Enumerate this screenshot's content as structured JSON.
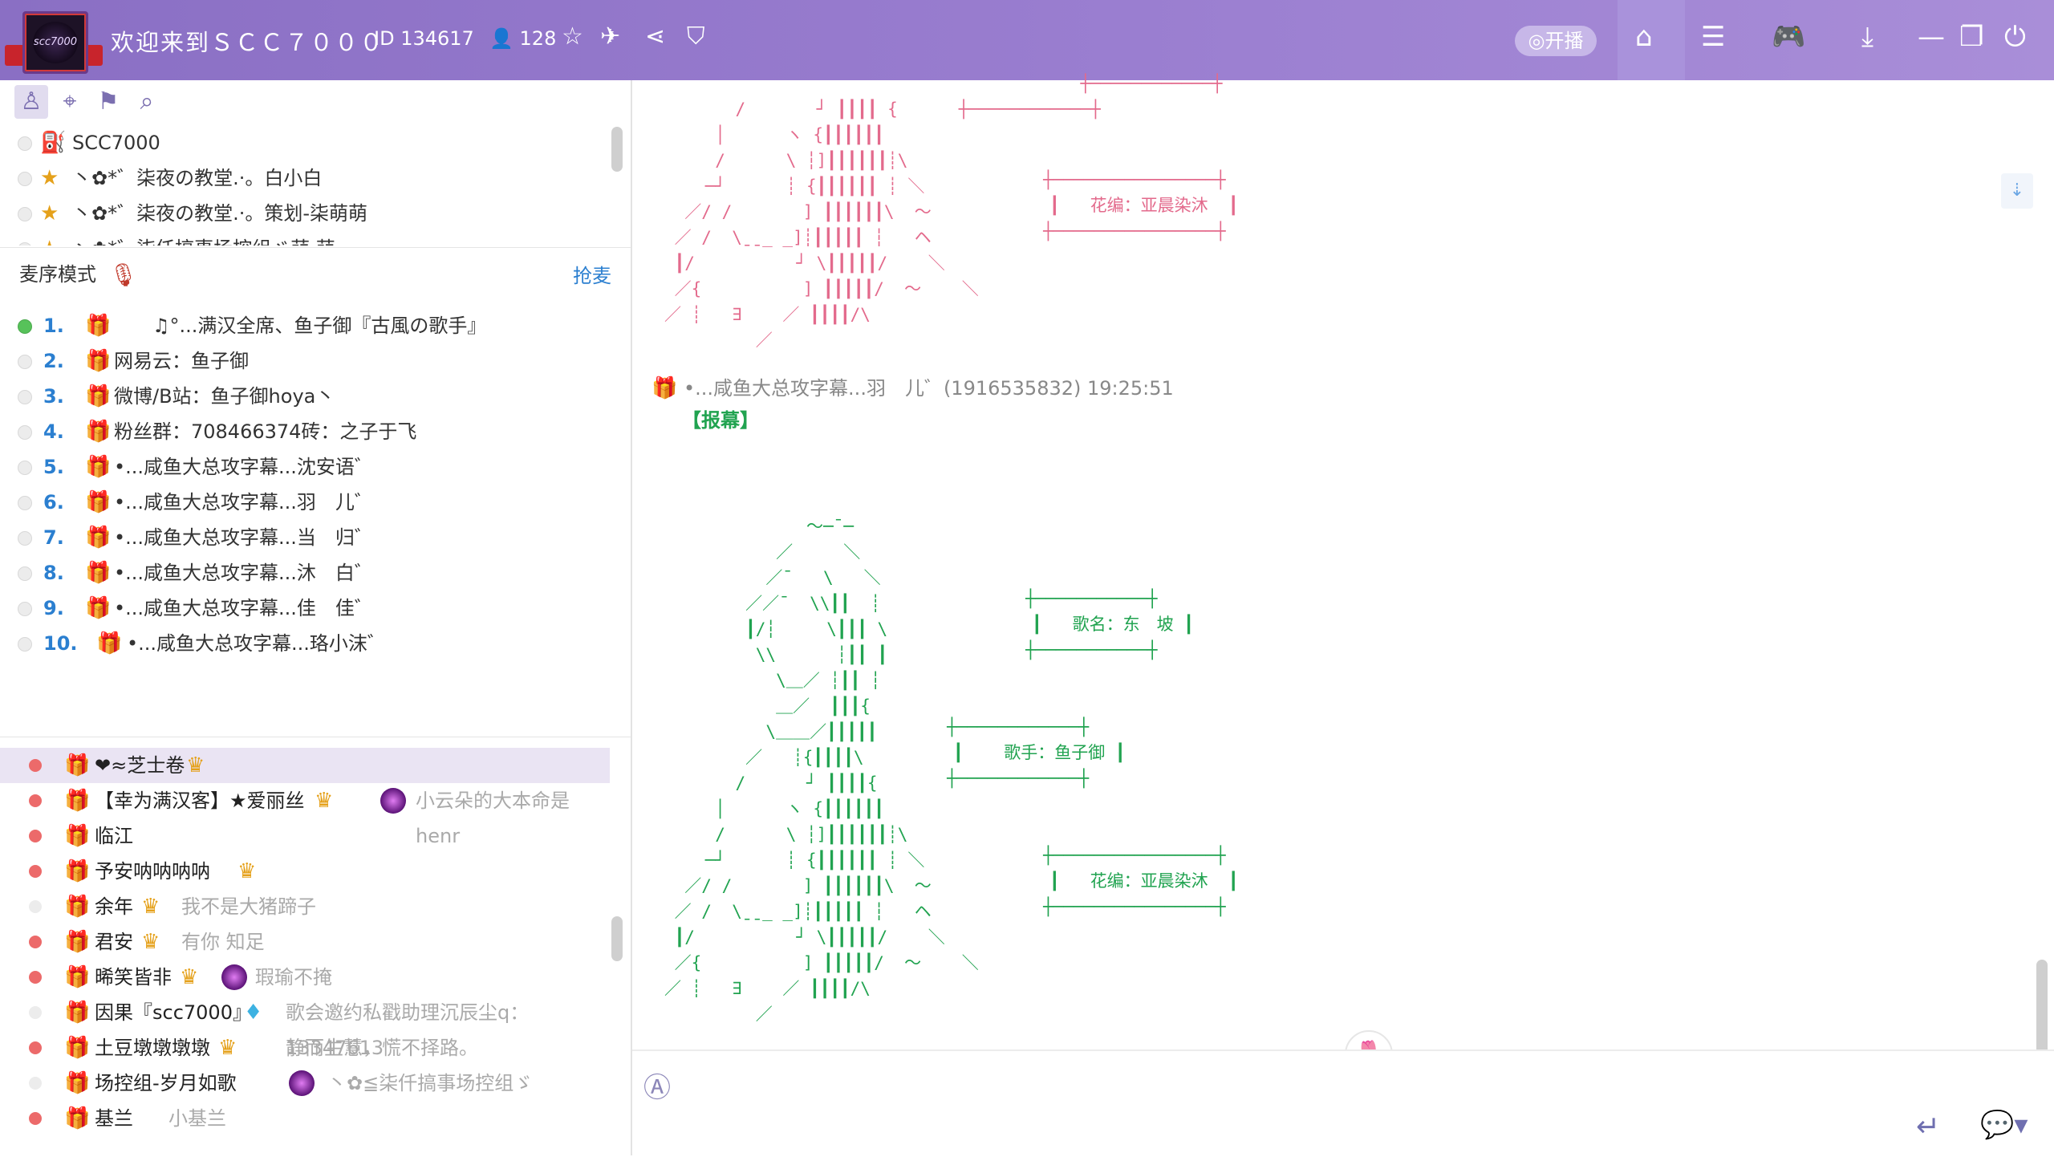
{
  "header": {
    "logo_text": "scc7000",
    "room_title": "欢迎来到ＳＣＣ７０００",
    "room_id": "ID 134617",
    "user_count": "128",
    "live_button": "开播"
  },
  "left_toolbar": [
    "user-icon",
    "location-icon",
    "bookmark-icon",
    "search-icon"
  ],
  "admins": [
    {
      "name": "SCC7000"
    },
    {
      "name": "丶✿*゛柒夜の教堂.·。白小白"
    },
    {
      "name": "丶✿*゛柒夜の教堂.·。策划-柒萌萌"
    },
    {
      "name": "丶✿*゛柒仟搞事场控组ゞ萌 萌"
    }
  ],
  "queue": {
    "label": "麦序模式",
    "grab_label": "抢麦",
    "items": [
      {
        "num": "1.",
        "name": "♫°...满汉全席、鱼子御『古風の歌手』"
      },
      {
        "num": "2.",
        "name": "网易云：鱼子御"
      },
      {
        "num": "3.",
        "name": "微博/B站：鱼子御hoya丶"
      },
      {
        "num": "4.",
        "name": "粉丝群：708466374砖：之子于飞"
      },
      {
        "num": "5.",
        "name": "•...咸鱼大总攻字幕...沈安语゛"
      },
      {
        "num": "6.",
        "name": "•...咸鱼大总攻字幕...羽　儿゛"
      },
      {
        "num": "7.",
        "name": "•...咸鱼大总攻字幕...当　归゛"
      },
      {
        "num": "8.",
        "name": "•...咸鱼大总攻字幕...沐　白゛"
      },
      {
        "num": "9.",
        "name": "•...咸鱼大总攻字幕...佳　佳゛"
      },
      {
        "num": "10.",
        "name": "•...咸鱼大总攻字幕...珞小沫゛"
      }
    ]
  },
  "members": [
    {
      "name": "❤≈芝士卷",
      "sign": ""
    },
    {
      "name": "【幸为满汉客】★爱丽丝",
      "sign": "小云朵的大本命是henr"
    },
    {
      "name": "临江",
      "sign": ""
    },
    {
      "name": "予安呐呐呐呐",
      "sign": ""
    },
    {
      "name": "余年",
      "sign": "我不是大猪蹄子"
    },
    {
      "name": "君安",
      "sign": "有你 知足"
    },
    {
      "name": "晞笑皆非",
      "sign": "瑕瑜不掩"
    },
    {
      "name": "因果『scc7000』",
      "sign": "歌会邀约私戳助理沉辰尘q：13347613"
    },
    {
      "name": "土豆墩墩墩墩",
      "sign": "静而生慧，慌不择路。"
    },
    {
      "name": "场控组-岁月如歌",
      "sign": "丶✿≦柒仟搞事场控组ゞ"
    },
    {
      "name": "基兰",
      "sign": "小基兰"
    }
  ],
  "chat": {
    "top_credit": "花编：亚晨染沐",
    "message_author": "•...咸鱼大总攻字幕...羽　儿゛(1916535832) 19:25:51",
    "message_tag": "【报幕】",
    "song_label": "歌名：东　坡",
    "singer_label": "歌手：鱼子御",
    "editor_label": "花编：亚晨染沐"
  },
  "colors": {
    "titlebar": "#9a7ed0",
    "accent_blue": "#2b7fd0",
    "ascii_pink": "#e36a8c",
    "ascii_green": "#21a350"
  }
}
